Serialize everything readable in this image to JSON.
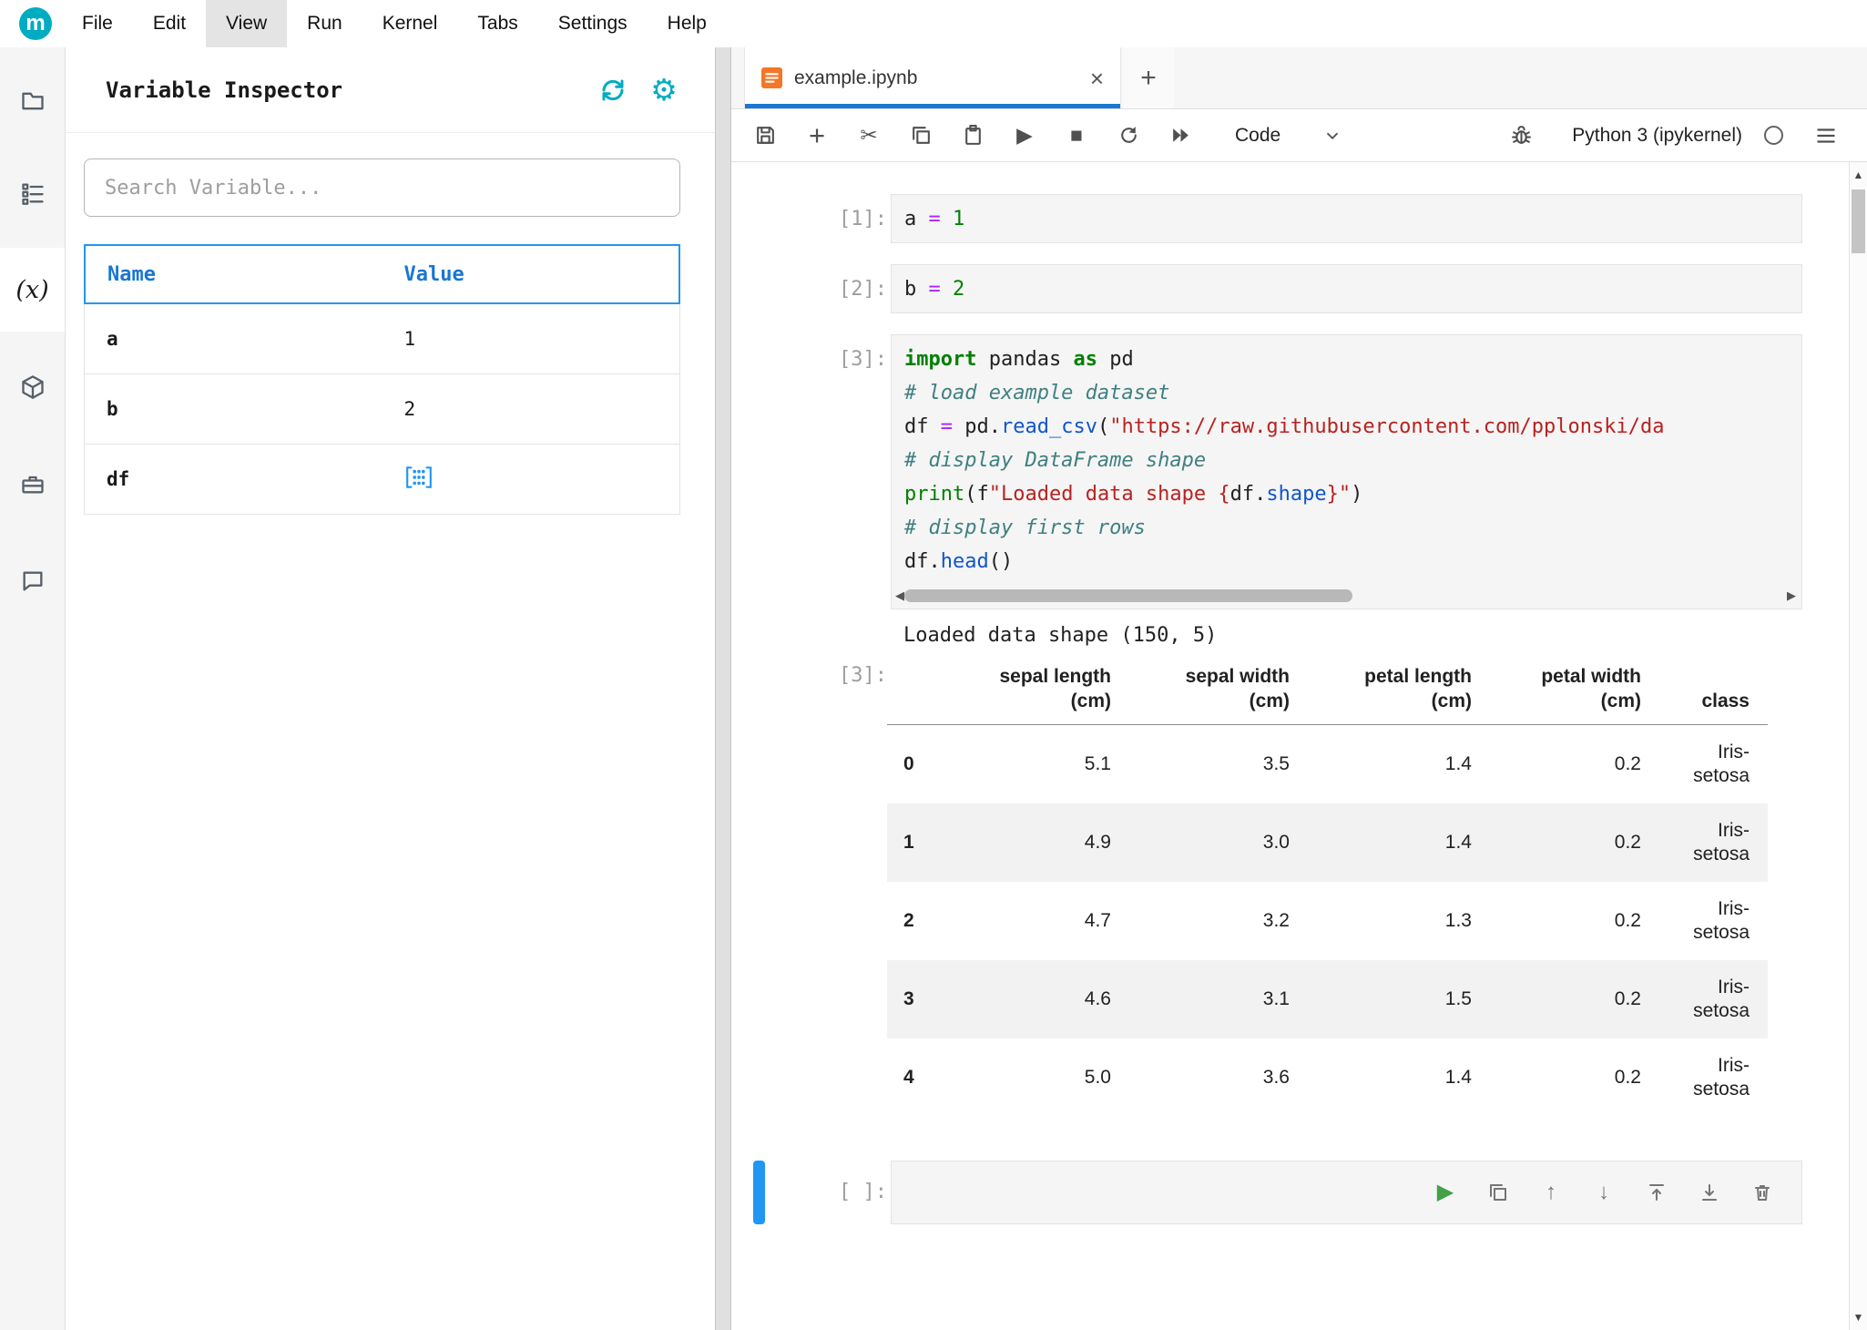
{
  "menu": {
    "items": [
      "File",
      "Edit",
      "View",
      "Run",
      "Kernel",
      "Tabs",
      "Settings",
      "Help"
    ],
    "active_item": "View"
  },
  "sidebar": {
    "title": "Variable Inspector",
    "search_placeholder": "Search Variable...",
    "columns": {
      "name": "Name",
      "value": "Value"
    },
    "variables": [
      {
        "name": "a",
        "value": "1"
      },
      {
        "name": "b",
        "value": "2"
      },
      {
        "name": "df",
        "value": "",
        "value_icon": "dataframe-grid-icon"
      }
    ]
  },
  "tabbar": {
    "active_tab": "example.ipynb"
  },
  "toolbar": {
    "cell_type": "Code",
    "kernel_name": "Python 3 (ipykernel)"
  },
  "notebook": {
    "cells": [
      {
        "prompt": "[1]:",
        "lines": [
          [
            {
              "t": "a ",
              "c": "p"
            },
            {
              "t": "=",
              "c": "o"
            },
            {
              "t": " ",
              "c": "p"
            },
            {
              "t": "1",
              "c": "n"
            }
          ]
        ]
      },
      {
        "prompt": "[2]:",
        "lines": [
          [
            {
              "t": "b ",
              "c": "p"
            },
            {
              "t": "=",
              "c": "o"
            },
            {
              "t": " ",
              "c": "p"
            },
            {
              "t": "2",
              "c": "n"
            }
          ]
        ]
      },
      {
        "prompt": "[3]:",
        "lines": [
          [
            {
              "t": "import",
              "c": "k"
            },
            {
              "t": " pandas ",
              "c": "p"
            },
            {
              "t": "as",
              "c": "k"
            },
            {
              "t": " pd",
              "c": "p"
            }
          ],
          [
            {
              "t": "# load example dataset",
              "c": "c"
            }
          ],
          [
            {
              "t": "df ",
              "c": "p"
            },
            {
              "t": "=",
              "c": "o"
            },
            {
              "t": " pd.",
              "c": "p"
            },
            {
              "t": "read_csv",
              "c": "f"
            },
            {
              "t": "(",
              "c": "p"
            },
            {
              "t": "\"https://raw.githubusercontent.com/pplonski/da",
              "c": "s"
            }
          ],
          [
            {
              "t": "# display DataFrame shape",
              "c": "c"
            }
          ],
          [
            {
              "t": "print",
              "c": "b"
            },
            {
              "t": "(f",
              "c": "p"
            },
            {
              "t": "\"Loaded data shape {",
              "c": "s"
            },
            {
              "t": "df.",
              "c": "p"
            },
            {
              "t": "shape",
              "c": "f"
            },
            {
              "t": "}\"",
              "c": "s"
            },
            {
              "t": ")",
              "c": "p"
            }
          ],
          [
            {
              "t": "# display first rows",
              "c": "c"
            }
          ],
          [
            {
              "t": "df.",
              "c": "p"
            },
            {
              "t": "head",
              "c": "f"
            },
            {
              "t": "()",
              "c": "p"
            }
          ]
        ]
      }
    ],
    "empty_prompt": "[ ]:",
    "stream_text": "Loaded data shape (150, 5)",
    "output_prompt": "[3]:",
    "output_table": {
      "columns": [
        [
          "sepal length",
          "(cm)"
        ],
        [
          "sepal width",
          "(cm)"
        ],
        [
          "petal length",
          "(cm)"
        ],
        [
          "petal width",
          "(cm)"
        ],
        [
          "class"
        ]
      ],
      "index": [
        "0",
        "1",
        "2",
        "3",
        "4"
      ],
      "rows": [
        [
          "5.1",
          "3.5",
          "1.4",
          "0.2",
          "Iris-setosa"
        ],
        [
          "4.9",
          "3.0",
          "1.4",
          "0.2",
          "Iris-setosa"
        ],
        [
          "4.7",
          "3.2",
          "1.3",
          "0.2",
          "Iris-setosa"
        ],
        [
          "4.6",
          "3.1",
          "1.5",
          "0.2",
          "Iris-setosa"
        ],
        [
          "5.0",
          "3.6",
          "1.4",
          "0.2",
          "Iris-setosa"
        ]
      ]
    }
  },
  "icons": {
    "logo_letter": "m",
    "settings_gear": "⚙",
    "close": "×",
    "add": "+",
    "cut": "✂",
    "run": "▶",
    "stop": "■",
    "up": "↑",
    "down": "↓",
    "scroll_up": "▲",
    "scroll_down": "▼",
    "scroll_left": "◀",
    "scroll_right": "▶",
    "variable_x": "(x)"
  },
  "colors": {
    "accent_teal": "#00acc1",
    "accent_blue": "#1976d2",
    "table_header_border": "#2196f3",
    "active_cell_bar": "#2196f3",
    "cell_background": "#f5f5f5",
    "notebook_icon_orange": "#f37726",
    "run_button_green": "#43a047"
  }
}
